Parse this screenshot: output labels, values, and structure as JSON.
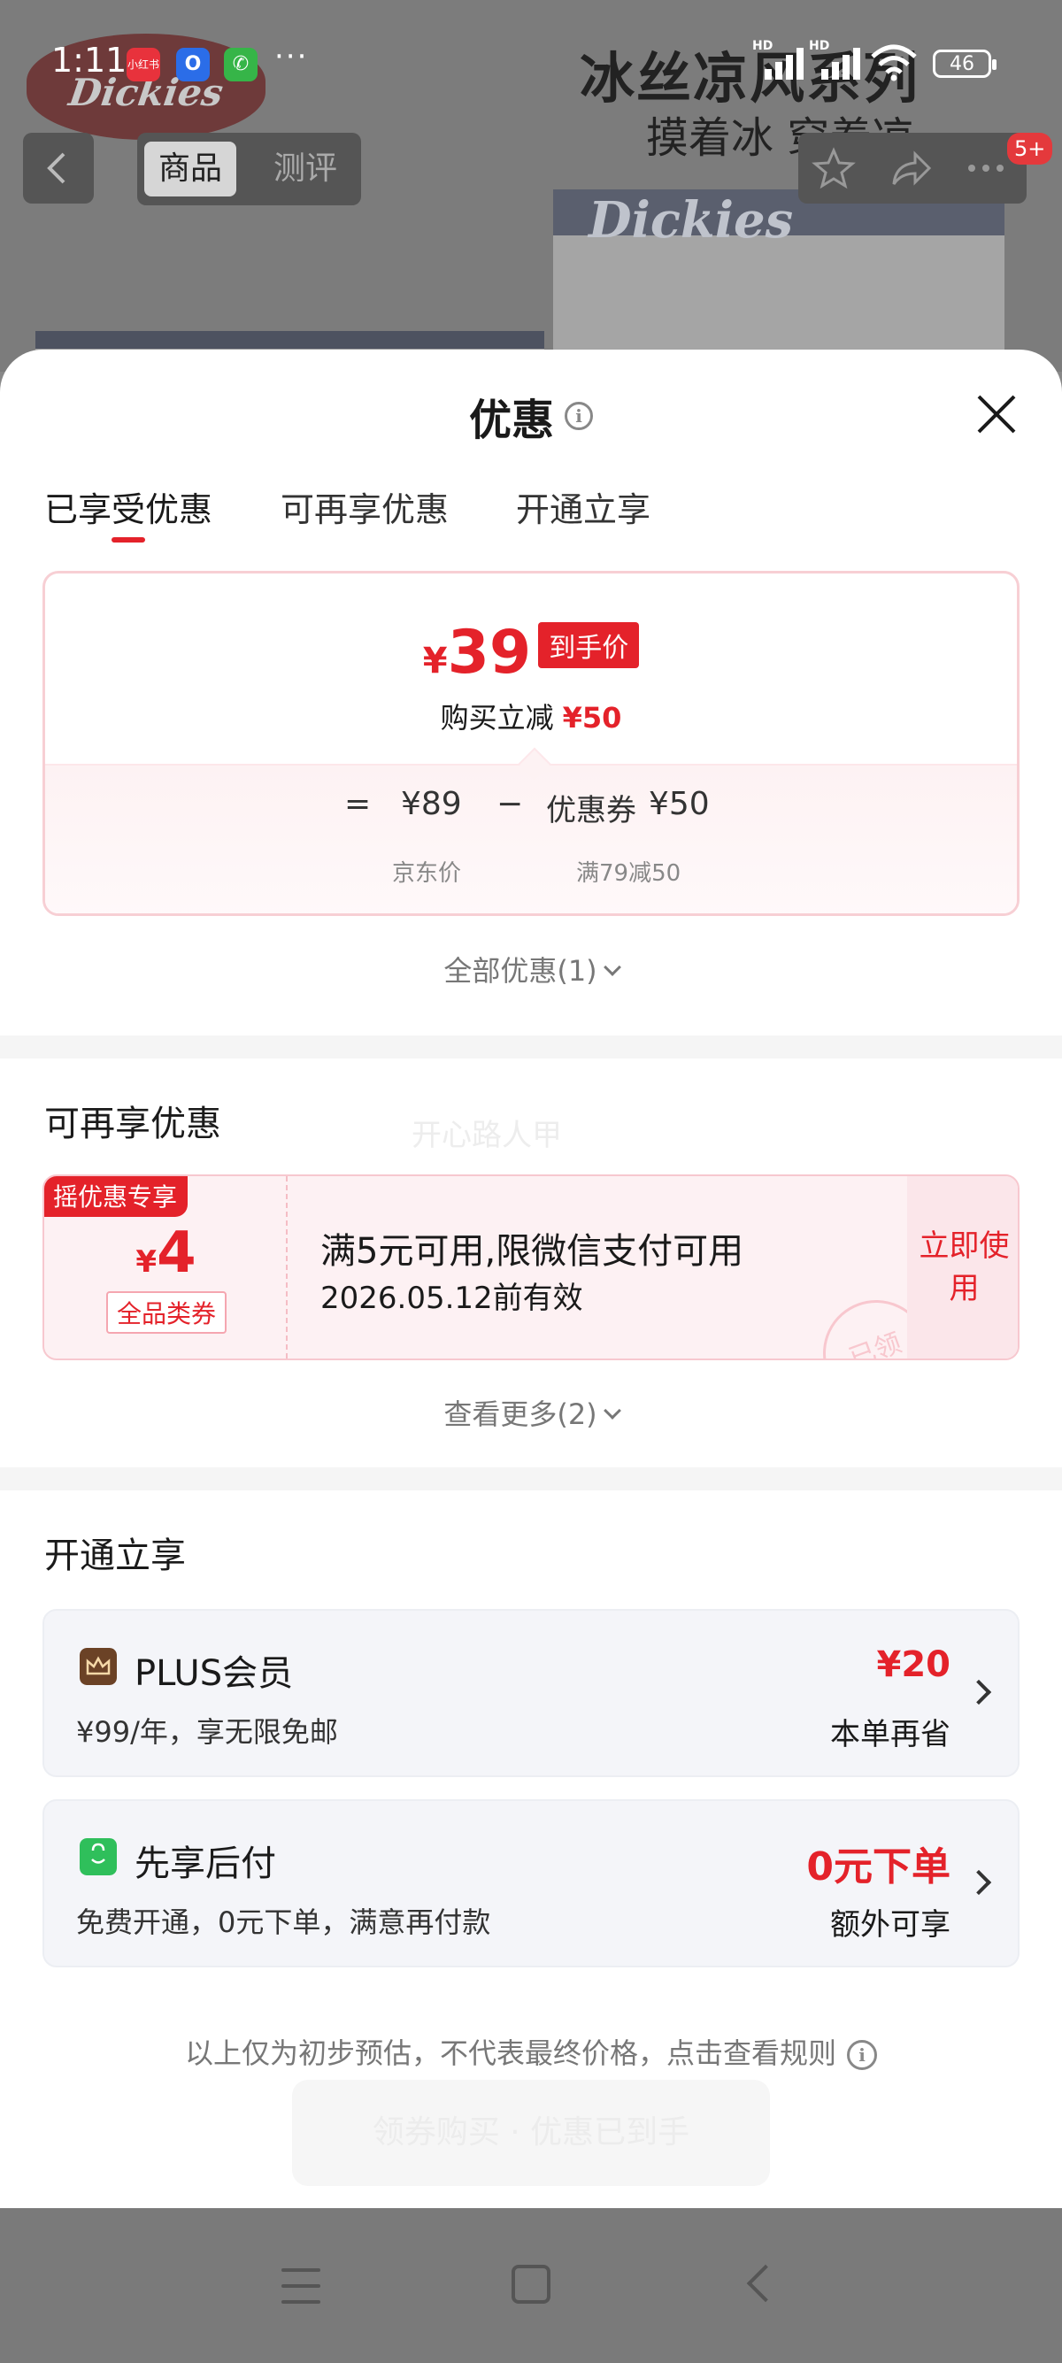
{
  "status_bar": {
    "time": "1:11",
    "apps": [
      "小红书",
      "O",
      "✆"
    ],
    "more": "···",
    "battery": "46",
    "signal_label": "HD"
  },
  "background_page": {
    "brand_logo": "Dickies",
    "slogan_line1": "冰丝凉风系列",
    "slogan_line2": "摸着冰 穿着凉",
    "nav": {
      "tab_product": "商品",
      "tab_review": "测评",
      "badge": "5+"
    }
  },
  "sheet": {
    "title": "优惠",
    "tabs": [
      "已享受优惠",
      "可再享优惠",
      "开通立享"
    ],
    "active_tab": 0,
    "price_card": {
      "currency": "¥",
      "final_price": "39",
      "final_label": "到手价",
      "instant_discount_label": "购买立减",
      "instant_discount_value": "¥50",
      "formula": {
        "equals": "=",
        "base_price": "¥89",
        "minus": "−",
        "coupon_label": "优惠券",
        "coupon_value": "¥50",
        "base_caption": "京东价",
        "coupon_caption": "满79减50"
      }
    },
    "all_discounts_link": "全部优惠(1)",
    "reusable": {
      "title": "可再享优惠",
      "watermark": "开心路人甲",
      "coupon": {
        "ribbon": "摇优惠专享",
        "currency": "¥",
        "amount": "4",
        "type": "全品类券",
        "description": "满5元可用,限微信支付可用",
        "valid_until": "2026.05.12前有效",
        "stamp": "已领",
        "action": "立即使用"
      },
      "view_more_link": "查看更多(2)"
    },
    "membership": {
      "title": "开通立享",
      "plus": {
        "name": "PLUS会员",
        "description": "¥99/年，享无限免邮",
        "value": "¥20",
        "note": "本单再省"
      },
      "pay_later": {
        "name": "先享后付",
        "description": "免费开通，0元下单，满意再付款",
        "value": "0元下单",
        "note": "额外可享"
      }
    },
    "disclaimer": "以上仅为初步预估，不代表最终价格，点击查看规则",
    "ghost_button": "领券购买 · 优惠已到手"
  },
  "colors": {
    "accent_red": "#e4222a",
    "plus_icon": "#6b4226",
    "pay_later_icon": "#2fbf5b"
  }
}
